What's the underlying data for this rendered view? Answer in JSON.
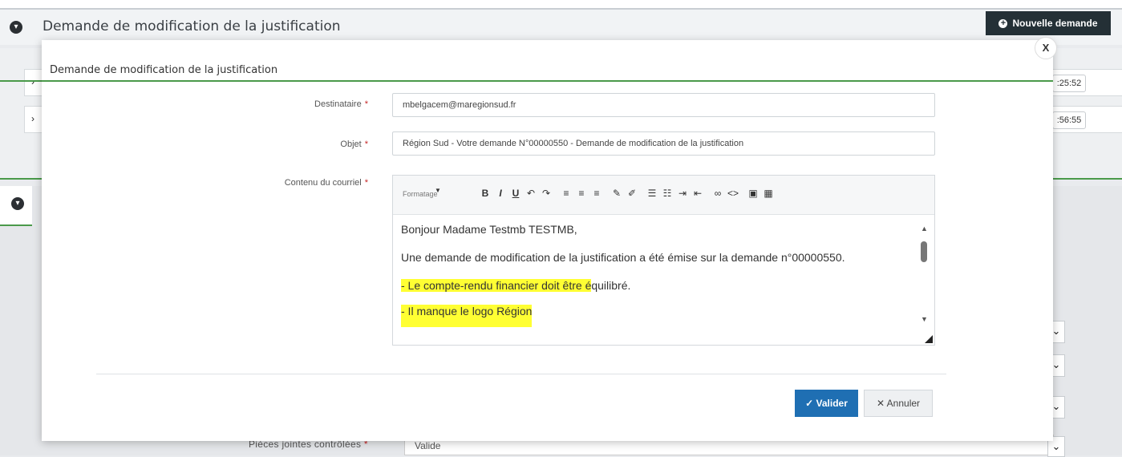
{
  "background": {
    "header_title": "Demande de modification de la justification",
    "new_request_button": "Nouvelle demande",
    "row_times": [
      ":25:52",
      ":56:55"
    ],
    "pieces_label": "Pièces jointes contrôlées",
    "pieces_required": "*",
    "pieces_value": "Valide"
  },
  "modal": {
    "title": "Demande de modification de la justification",
    "close": "X",
    "fields": {
      "destinataire_label": "Destinataire",
      "destinataire_value": "mbelgacem@maregionsud.fr",
      "objet_label": "Objet",
      "objet_value": "Région Sud - Votre demande N°00000550 - Demande de modification de la justification",
      "contenu_label": "Contenu du courriel",
      "required": "*"
    },
    "editor": {
      "format_label": "Formatage",
      "format_caret": "▼",
      "toolbar_icons": [
        "bold-icon",
        "italic-icon",
        "underline-icon",
        "undo-icon",
        "redo-icon",
        "align-left-icon",
        "align-center-icon",
        "align-right-icon",
        "brush-icon",
        "eraser-icon",
        "bullet-list-icon",
        "numbered-list-icon",
        "indent-icon",
        "outdent-icon",
        "link-icon",
        "code-icon",
        "image-icon",
        "table-icon"
      ],
      "toolbar_glyphs": [
        "B",
        "I",
        "U",
        "↶",
        "↷",
        "≡",
        "≡",
        "≡",
        "✎",
        "✐",
        "☰",
        "☷",
        "⇥",
        "⇤",
        "∞",
        "<>",
        "▣",
        "▦"
      ],
      "paragraphs": [
        {
          "text": "Bonjour Madame Testmb TESTMB,",
          "highlight": ""
        },
        {
          "text": "Une demande de modification de la justification a été émise sur la demande n°00000550.",
          "highlight": ""
        },
        {
          "hl": "- Le compte-rendu financier doit être é",
          "rest": "quilibré."
        },
        {
          "hl": "- Il manque le logo Région",
          "rest": ""
        }
      ]
    },
    "buttons": {
      "valider": "✓ Valider",
      "annuler": "✕ Annuler"
    }
  },
  "colors": {
    "primary": "#1f6fb3",
    "dark": "#243036",
    "highlight": "#ffff33",
    "accent_line": "#4a9a4a",
    "required": "#c62828"
  }
}
